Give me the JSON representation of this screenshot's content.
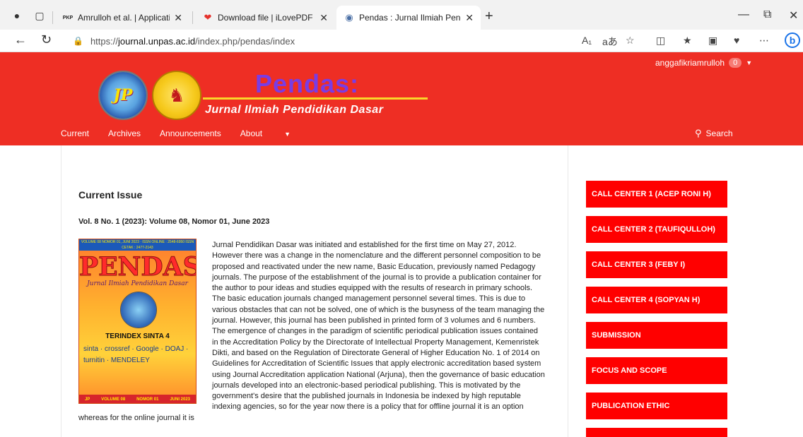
{
  "browser": {
    "tabs": [
      {
        "favicon": "PKP",
        "title": "Amrulloh et al. | Application of th"
      },
      {
        "favicon": "heart-icon",
        "title": "Download file | iLovePDF"
      },
      {
        "favicon": "globe-icon",
        "title": "Pendas : Jurnal Ilmiah Pendidikan"
      }
    ],
    "url_prefix": "https://",
    "url_host": "journal.unpas.ac.id",
    "url_path": "/index.php/pendas/index"
  },
  "site": {
    "user": "anggafikriamrulloh",
    "notifications": "0",
    "brand_title": "Pendas:",
    "brand_subtitle": "Jurnal Ilmiah Pendidikan Dasar",
    "nav": [
      "Current",
      "Archives",
      "Announcements",
      "About"
    ],
    "search_label": "Search"
  },
  "main": {
    "section_title": "Current Issue",
    "issue_title": "Vol. 8 No. 1 (2023): Volume 08, Nomor 01, June 2023",
    "cover": {
      "band": "VOLUME 08 NOMOR 01, JUNI 2023 · ISSN ONLINE : 2548-6950 ISSN CETAK : 2477-2143",
      "title": "PENDAS",
      "subtitle": "Jurnal Ilmiah Pendidikan Dasar",
      "sinta": "TERINDEX SINTA 4",
      "indexers": "sinta · crossref · Google · DOAJ · turnitin · MENDELEY",
      "footer": [
        "JP",
        "VOLUME 08",
        "NOMOR 01",
        "JUNI 2023"
      ]
    },
    "description": "Jurnal Pendidikan Dasar was initiated and established for the first time on May 27, 2012. However there was a change in the nomenclature and the different personnel composition to be proposed and reactivated under the new name, Basic Education, previously named Pedagogy journals. The purpose of the establishment of the journal is to provide a publication container for the author to pour ideas and studies equipped with the results of research in primary schools.  The basic education journals changed management personnel several times. This is due to various obstacles that can not be solved, one of which is the busyness of the team managing the journal. However, this journal has been published in printed form of 3 volumes and 6 numbers. The emergence of changes in the paradigm of scientific periodical publication issues contained in the Accreditation Policy by the Directorate of Intellectual Property Management, Kemenristek Dikti, and based on the Regulation of Directorate General of Higher Education No. 1 of 2014 on Guidelines for Accreditation of Scientific Issues that apply electronic accreditation based system using Journal Accreditation application National (Arjuna), then the governance of basic education journals developed into an electronic-based periodical publishing. This is motivated by the government's desire that the published journals in Indonesia be indexed by high reputable indexing agencies, so for the year now there is a policy that for offline journal it is an option whereas for the online journal it is"
  },
  "sidebar": {
    "buttons": [
      "CALL CENTER 1 (ACEP RONI H)",
      "CALL CENTER 2 (TAUFIQULLOH)",
      "CALL CENTER 3 (FEBY I)",
      "CALL CENTER 4 (SOPYAN H)",
      "SUBMISSION",
      "FOCUS AND SCOPE",
      "PUBLICATION ETHIC"
    ]
  },
  "colors": {
    "header_red": "#ee2e24",
    "button_red": "#ff0000",
    "brand_purple": "#7a3ce4",
    "rule_yellow": "#f9d62a"
  }
}
